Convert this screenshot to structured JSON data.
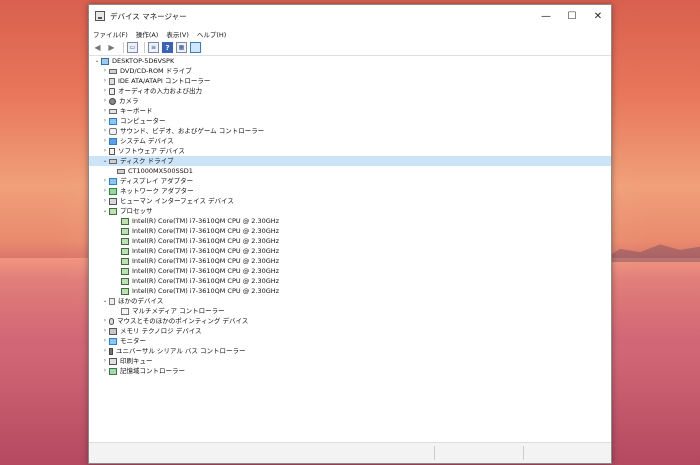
{
  "window": {
    "title": "デバイス マネージャー",
    "controls": {
      "minimize": "—",
      "maximize": "☐",
      "close": "✕"
    }
  },
  "menu": [
    "ファイル(F)",
    "操作(A)",
    "表示(V)",
    "ヘルプ(H)"
  ],
  "toolbar": {
    "back": "◀",
    "forward": "▶",
    "help": "?"
  },
  "tree": {
    "root": "DESKTOP-5D6VSPK",
    "categories": {
      "dvd": "DVD/CD-ROM ドライブ",
      "ide": "IDE ATA/ATAPI コントローラー",
      "audio_io": "オーディオの入力および出力",
      "camera": "カメラ",
      "keyboard": "キーボード",
      "computer": "コンピューター",
      "sound": "サウンド、ビデオ、およびゲーム コントローラー",
      "system": "システム デバイス",
      "software": "ソフトウェア デバイス",
      "disk": "ディスク ドライブ",
      "disk_child": "CT1000MX500SSD1",
      "display": "ディスプレイ アダプター",
      "network": "ネットワーク アダプター",
      "hid": "ヒューマン インターフェイス デバイス",
      "processor": "プロセッサ",
      "processor_children": [
        "Intel(R) Core(TM) i7-3610QM CPU @ 2.30GHz",
        "Intel(R) Core(TM) i7-3610QM CPU @ 2.30GHz",
        "Intel(R) Core(TM) i7-3610QM CPU @ 2.30GHz",
        "Intel(R) Core(TM) i7-3610QM CPU @ 2.30GHz",
        "Intel(R) Core(TM) i7-3610QM CPU @ 2.30GHz",
        "Intel(R) Core(TM) i7-3610QM CPU @ 2.30GHz",
        "Intel(R) Core(TM) i7-3610QM CPU @ 2.30GHz",
        "Intel(R) Core(TM) i7-3610QM CPU @ 2.30GHz"
      ],
      "other": "ほかのデバイス",
      "other_child": "マルチメディア コントローラー",
      "mouse": "マウスとそのほかのポインティング デバイス",
      "memory": "メモリ テクノロジ デバイス",
      "monitor": "モニター",
      "usb": "ユニバーサル シリアル バス コントローラー",
      "print": "印刷キュー",
      "storage": "記憶域コントローラー"
    },
    "chevrons": {
      "collapsed": "›",
      "expanded": "⌄"
    }
  },
  "colors": {
    "selection": "#cce4f7",
    "window_bg": "#ffffff"
  }
}
